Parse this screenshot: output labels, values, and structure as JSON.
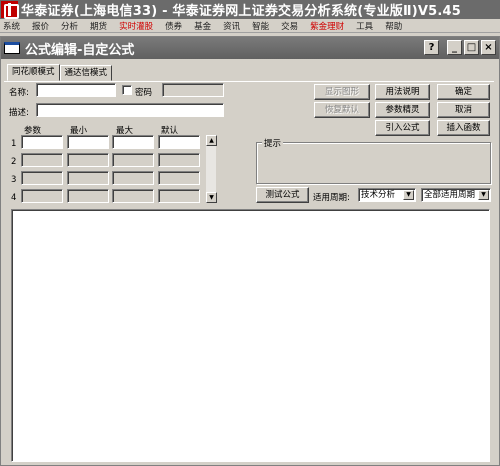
{
  "app": {
    "title": "华泰证券(上海电信33) - 华泰证券网上证券交易分析系统(专业版Ⅱ)V5.45"
  },
  "menu": [
    {
      "label": "系统",
      "red": false
    },
    {
      "label": "报价",
      "red": false
    },
    {
      "label": "分析",
      "red": false
    },
    {
      "label": "期货",
      "red": false
    },
    {
      "label": "实时灌股",
      "red": true
    },
    {
      "label": "债券",
      "red": false
    },
    {
      "label": "基金",
      "red": false
    },
    {
      "label": "资讯",
      "red": false
    },
    {
      "label": "智能",
      "red": false
    },
    {
      "label": "交易",
      "red": false
    },
    {
      "label": "紫金理财",
      "red": true
    },
    {
      "label": "工具",
      "red": false
    },
    {
      "label": "帮助",
      "red": false
    }
  ],
  "dialog": {
    "title": "公式编辑-自定公式",
    "help_btn": "?",
    "min_btn": "_",
    "max_btn": "□",
    "close_btn": "×"
  },
  "tabs": [
    {
      "label": "同花顺模式",
      "active": true
    },
    {
      "label": "通达信模式",
      "active": false
    }
  ],
  "form": {
    "name_label": "名称:",
    "name_value": "",
    "password_label": "密码",
    "password_checked": false,
    "desc_label": "描述:",
    "desc_value": ""
  },
  "buttons": {
    "show_chart": "显示图形",
    "restore_default": "恢复默认",
    "usage": "用法说明",
    "param_tune": "参数精灵",
    "import_formula": "引入公式",
    "ok": "确定",
    "cancel": "取消",
    "insert_func": "插入函数",
    "test_formula": "测试公式"
  },
  "params": {
    "headers": [
      "参数",
      "最小",
      "最大",
      "默认"
    ],
    "rows": [
      "1",
      "2",
      "3",
      "4"
    ]
  },
  "hint": {
    "label": "提示"
  },
  "period": {
    "label": "适用周期:",
    "type_value": "技术分析",
    "range_value": "全部适用周期"
  },
  "icons": {
    "scroll_up": "▲",
    "scroll_down": "▼",
    "combo_arrow": "▼"
  }
}
